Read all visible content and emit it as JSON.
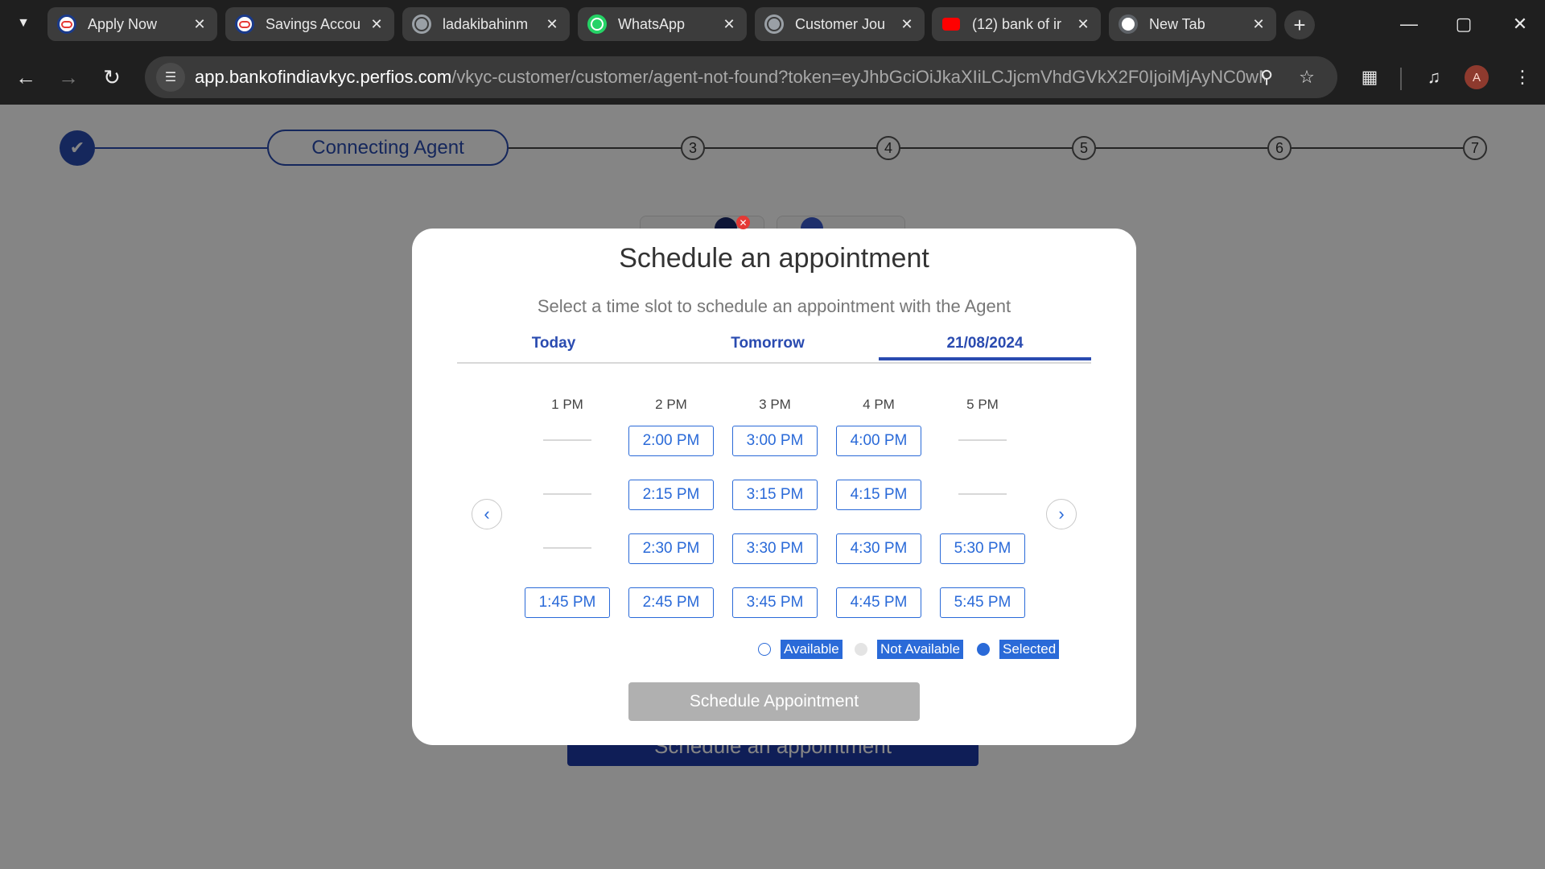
{
  "browser": {
    "tabs": [
      {
        "title": "Apply Now",
        "favicon": "bank-of-india-icon"
      },
      {
        "title": "Savings Accou",
        "favicon": "bank-of-india-icon"
      },
      {
        "title": "ladakibahinm",
        "favicon": "globe-icon"
      },
      {
        "title": "WhatsApp",
        "favicon": "whatsapp-icon"
      },
      {
        "title": "Customer Jou",
        "favicon": "globe-icon"
      },
      {
        "title": "(12) bank of ir",
        "favicon": "youtube-icon"
      },
      {
        "title": "New Tab",
        "favicon": "chrome-icon"
      }
    ],
    "url_host": "app.bankofindiavkyc.perfios.com",
    "url_path": "/vkyc-customer/customer/agent-not-found?token=eyJhbGciOiJkaXIiLCJjcmVhdGVkX2F0IjoiMjAyNC0wMi0y...",
    "profile_initial": "A"
  },
  "stepper": {
    "current_label": "Connecting Agent",
    "steps": [
      "3",
      "4",
      "5",
      "6",
      "7"
    ]
  },
  "background": {
    "button_label": "Schedule an appointment"
  },
  "modal": {
    "title": "Schedule an appointment",
    "subtitle": "Select a time slot to schedule an appointment with the Agent",
    "tabs": [
      "Today",
      "Tomorrow",
      "21/08/2024"
    ],
    "active_tab": "21/08/2024",
    "hours": [
      "1 PM",
      "2 PM",
      "3 PM",
      "4 PM",
      "5 PM"
    ],
    "slots": {
      "h1": [
        null,
        null,
        null,
        "1:45 PM"
      ],
      "h2": [
        "2:00 PM",
        "2:15 PM",
        "2:30 PM",
        "2:45 PM"
      ],
      "h3": [
        "3:00 PM",
        "3:15 PM",
        "3:30 PM",
        "3:45 PM"
      ],
      "h4": [
        "4:00 PM",
        "4:15 PM",
        "4:30 PM",
        "4:45 PM"
      ],
      "h5": [
        null,
        null,
        "5:30 PM",
        "5:45 PM"
      ]
    },
    "legend": {
      "available": "Available",
      "not_available": "Not Available",
      "selected": "Selected"
    },
    "schedule_button": "Schedule Appointment"
  },
  "colors": {
    "accent": "#2a4bb0",
    "slot_border": "#2a6ad8",
    "disabled_button": "#b0b0b0"
  }
}
